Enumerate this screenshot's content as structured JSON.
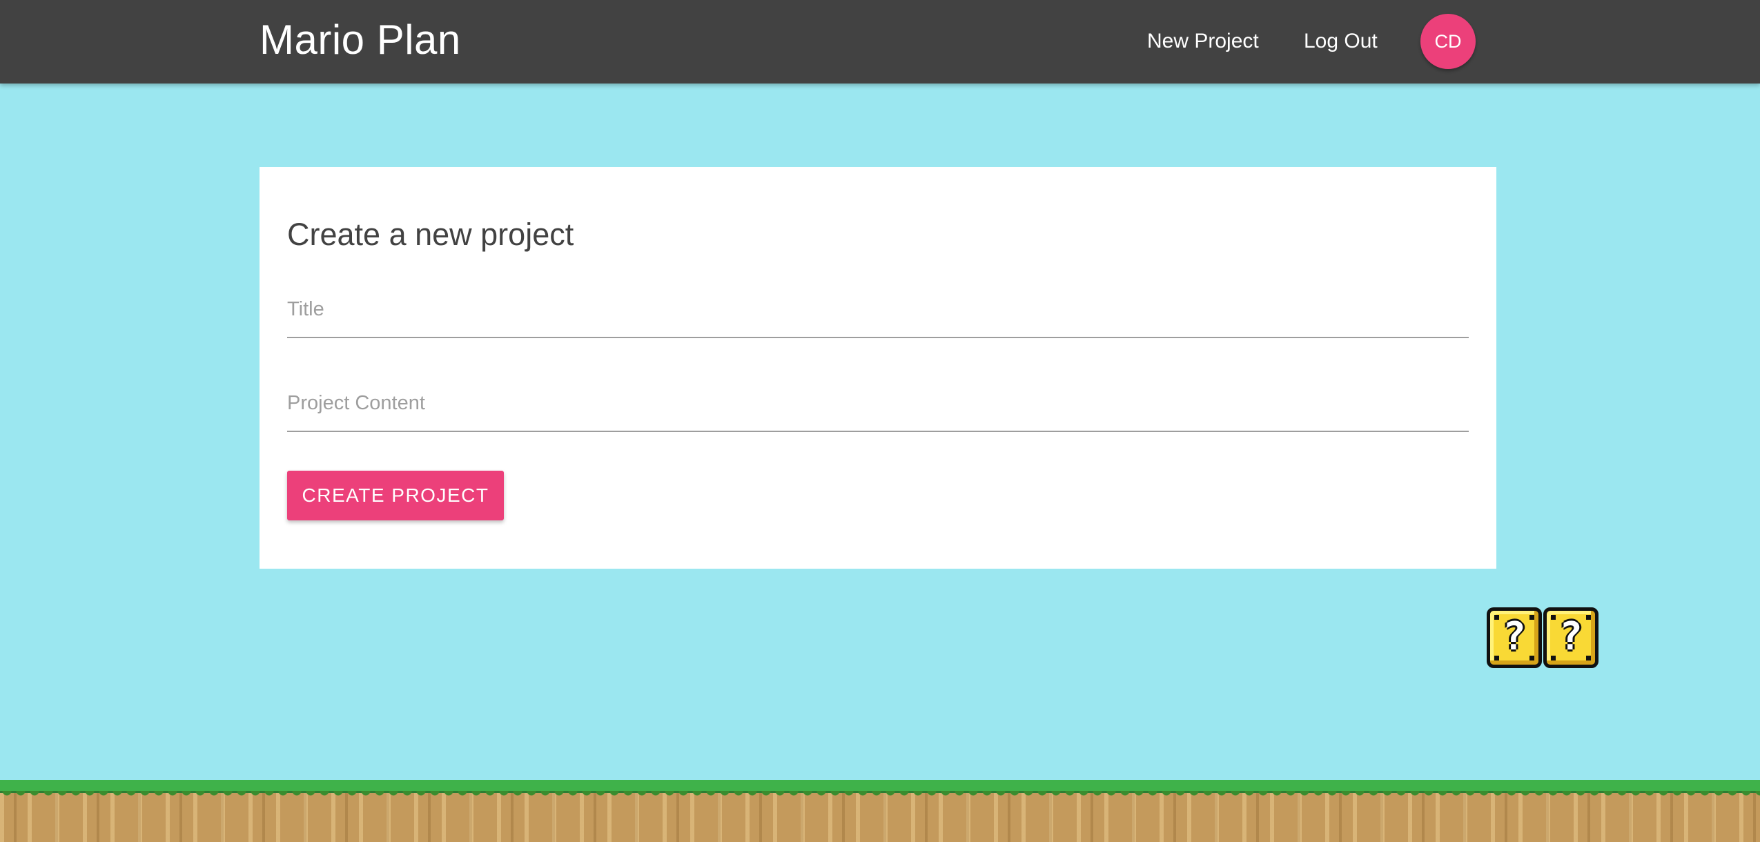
{
  "navbar": {
    "brand": "Mario Plan",
    "links": {
      "new_project": "New Project",
      "log_out": "Log Out"
    },
    "avatar_initials": "CD",
    "background_color": "#424242",
    "avatar_color": "#ec407a"
  },
  "form": {
    "heading": "Create a new project",
    "fields": {
      "title": {
        "label": "Title",
        "value": ""
      },
      "content": {
        "label": "Project Content",
        "value": ""
      }
    },
    "submit_label": "CREATE PROJECT",
    "button_color": "#ec407a"
  },
  "scene": {
    "sky_color": "#9be7f0",
    "grass_color": "#3fb24a",
    "dirt_color": "#c49a5c",
    "question_blocks": [
      {
        "symbol": "?",
        "icon": "question-block-icon"
      },
      {
        "symbol": "?",
        "icon": "question-block-icon"
      }
    ]
  }
}
